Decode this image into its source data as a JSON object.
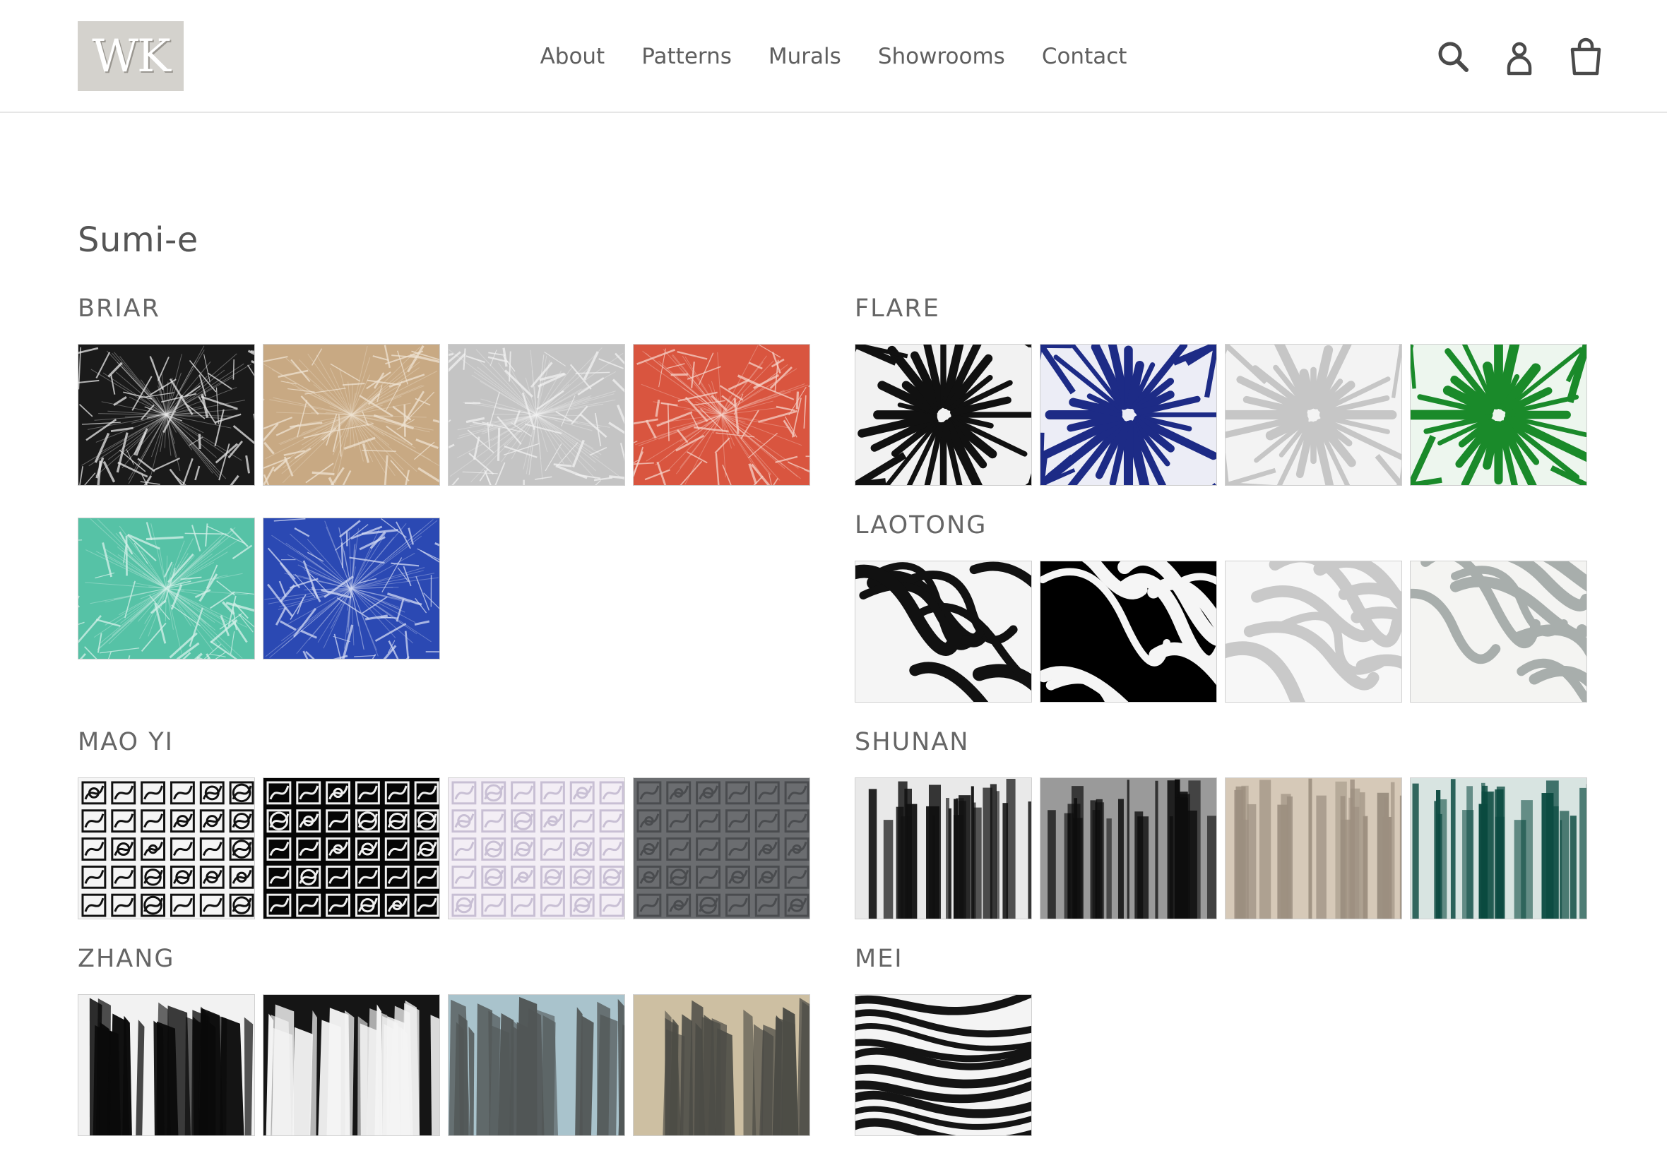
{
  "logo": {
    "text": "WK"
  },
  "nav": {
    "items": [
      "About",
      "Patterns",
      "Murals",
      "Showrooms",
      "Contact"
    ]
  },
  "header_icons": [
    "search-icon",
    "account-icon",
    "cart-icon"
  ],
  "page_title": "Sumi-e",
  "collections": [
    {
      "name": "BRIAR",
      "style": "weave",
      "colors": [
        [
          "#1a1a1a",
          "#e8e8e8"
        ],
        [
          "#c8a983",
          "#efe3d2"
        ],
        [
          "#c4c4c4",
          "#f2f2f2"
        ],
        [
          "#d9553f",
          "#f6d2c8"
        ],
        [
          "#56c2a6",
          "#d6f1ea"
        ],
        [
          "#2b49b3",
          "#d2daf3"
        ]
      ]
    },
    {
      "name": "FLARE",
      "style": "star",
      "colors": [
        [
          "#111111",
          "#f2f2f2"
        ],
        [
          "#1d2b86",
          "#ecedf6"
        ],
        [
          "#c6c6c6",
          "#f3f3f3"
        ],
        [
          "#1a8a2a",
          "#edf6ee"
        ]
      ]
    },
    {
      "name": "LAOTONG",
      "style": "wave",
      "colors": [
        [
          "#111111",
          "#f5f5f5"
        ],
        [
          "#f5f5f5",
          "#000000"
        ],
        [
          "#c9c9c9",
          "#f7f7f7"
        ],
        [
          "#a8aeac",
          "#f4f4f2"
        ]
      ]
    },
    {
      "name": "MAO YI",
      "style": "glyph",
      "colors": [
        [
          "#111111",
          "#f5f5f5"
        ],
        [
          "#f0f0f0",
          "#050505"
        ],
        [
          "#c8bfd4",
          "#f3eef5"
        ],
        [
          "#4a4c4f",
          "#6b6d70"
        ]
      ]
    },
    {
      "name": "SHUNAN",
      "style": "stripe",
      "colors": [
        [
          "#111111",
          "#e9e9e9"
        ],
        [
          "#0d0d0d",
          "#9a9a9a"
        ],
        [
          "#9c8f80",
          "#d6c9b8"
        ],
        [
          "#0b4a40",
          "#d8e4e1"
        ]
      ]
    },
    {
      "name": "ZHANG",
      "style": "brush",
      "colors": [
        [
          "#0a0a0a",
          "#f2f2f2"
        ],
        [
          "#f4f4f4",
          "#151515"
        ],
        [
          "#515656",
          "#a9c3cc"
        ],
        [
          "#4c4c46",
          "#cdbfa2"
        ]
      ]
    },
    {
      "name": "MEI",
      "style": "marble",
      "colors": [
        [
          "#141414",
          "#f4f4f4"
        ]
      ]
    }
  ]
}
